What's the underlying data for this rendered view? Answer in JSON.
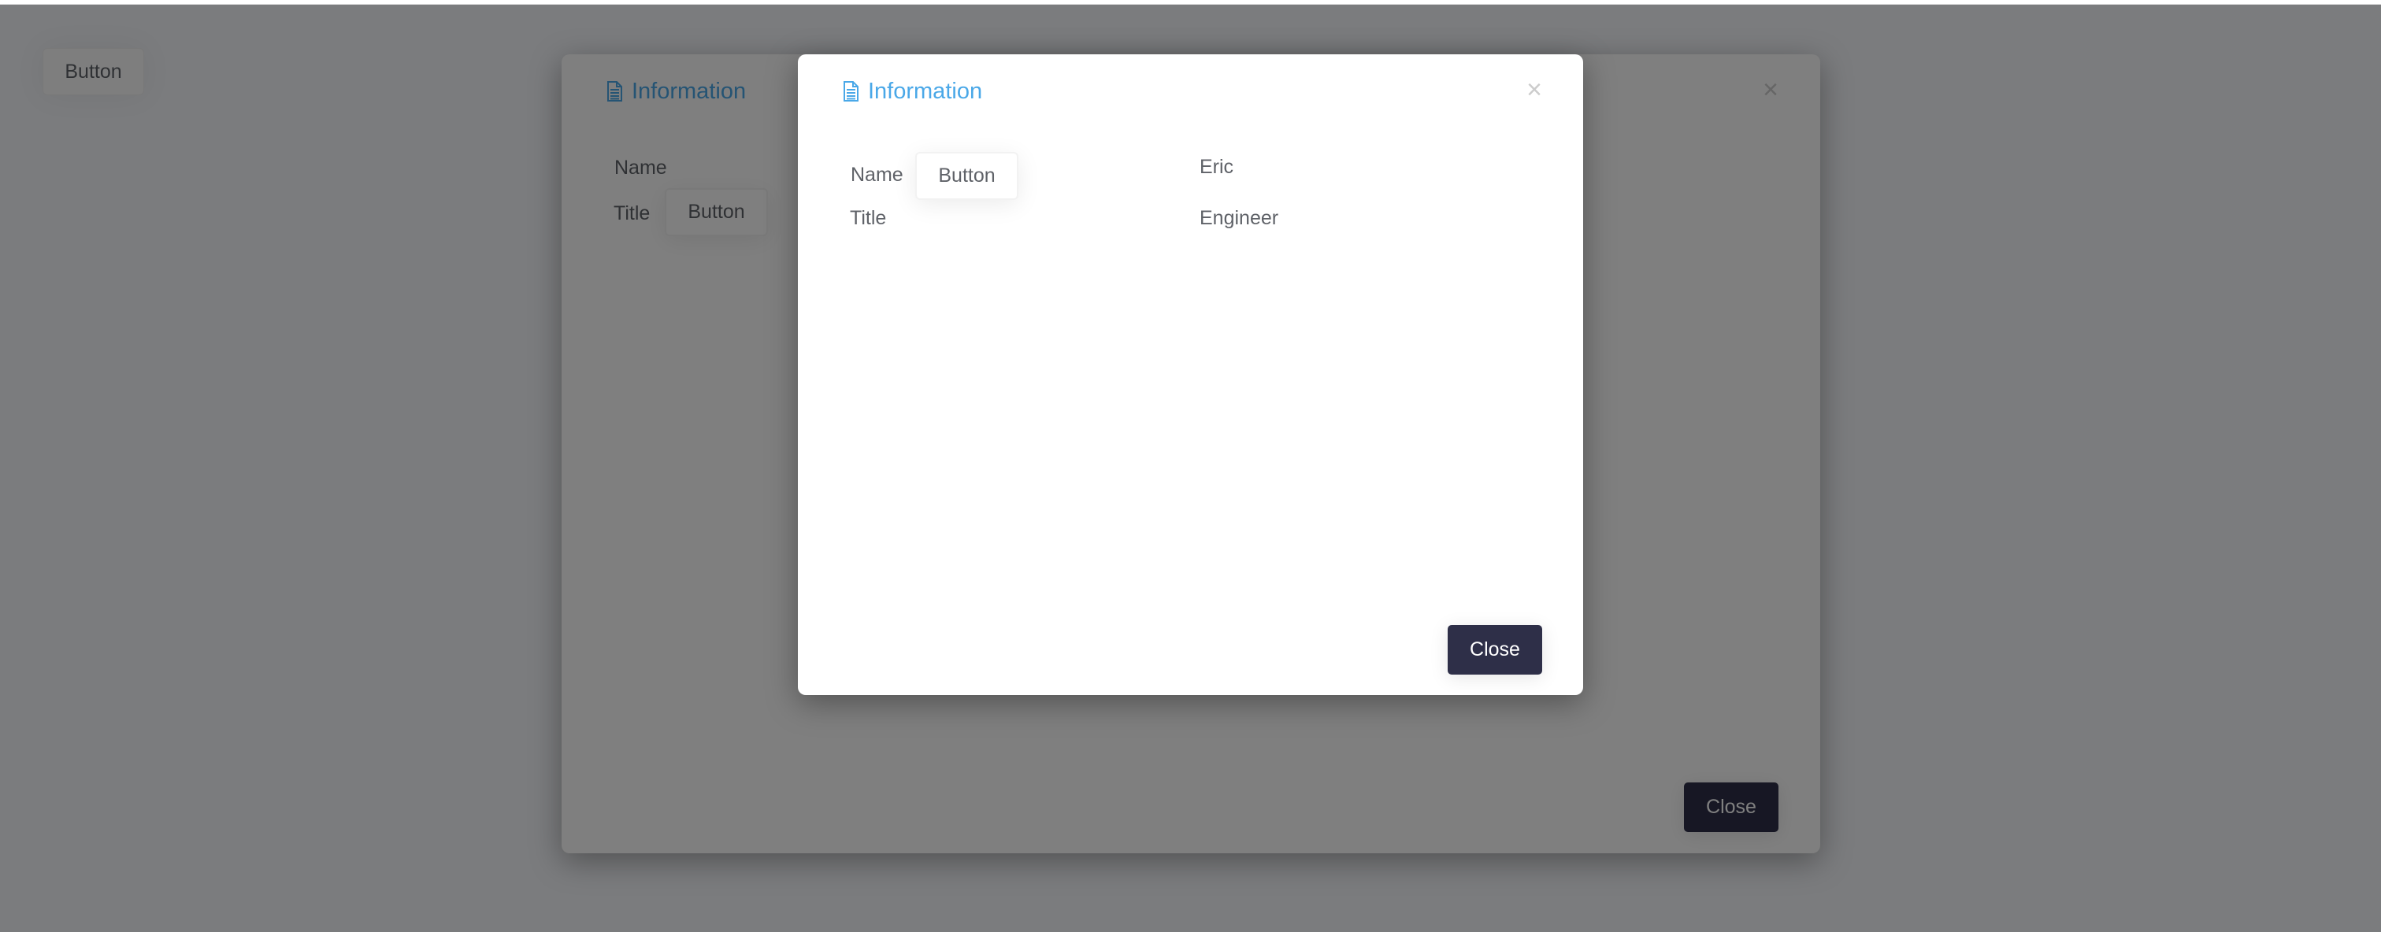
{
  "page": {
    "button_label": "Button"
  },
  "modal_back": {
    "title": "Information",
    "title_icon": "document-icon",
    "close_icon": "close-icon",
    "close_glyph": "×",
    "fields": [
      {
        "label": "Name",
        "value": ""
      },
      {
        "label": "Title",
        "value": ""
      }
    ],
    "inner_button_label": "Button",
    "close_button_label": "Close"
  },
  "modal_front": {
    "title": "Information",
    "title_icon": "document-icon",
    "close_icon": "close-icon",
    "close_glyph": "×",
    "fields": [
      {
        "label": "Name",
        "value": "Eric"
      },
      {
        "label": "Title",
        "value": "Engineer"
      }
    ],
    "inner_button_label": "Button",
    "close_button_label": "Close"
  },
  "colors": {
    "accent_title": "#4aa8e8",
    "close_button_bg": "#2e2f48",
    "overlay": "rgba(0,0,0,0.5)"
  }
}
